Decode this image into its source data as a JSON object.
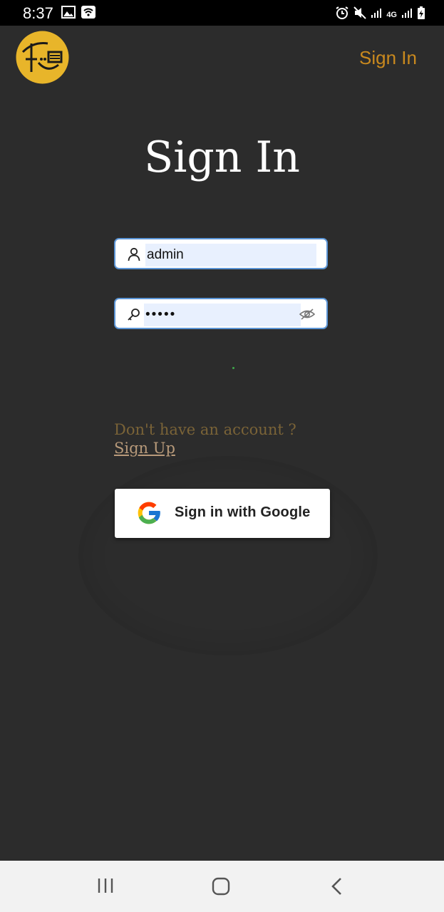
{
  "status_bar": {
    "time": "8:37",
    "network": "4G"
  },
  "header": {
    "logo_icon": "app-logo",
    "signin_link": "Sign In"
  },
  "main": {
    "title": "Sign In",
    "username": {
      "value": "admin",
      "icon": "person-icon"
    },
    "password": {
      "value": "•••••",
      "icon": "key-icon",
      "toggle_icon": "eye-off-icon"
    },
    "signup_prompt": "Don't have an account ? ",
    "signup_link": "Sign Up",
    "google_button": "Sign in with Google"
  },
  "colors": {
    "accent": "#c9891e",
    "background": "#2c2c2c",
    "field_border": "#5b95d6",
    "autofill": "#e8f0fe"
  }
}
